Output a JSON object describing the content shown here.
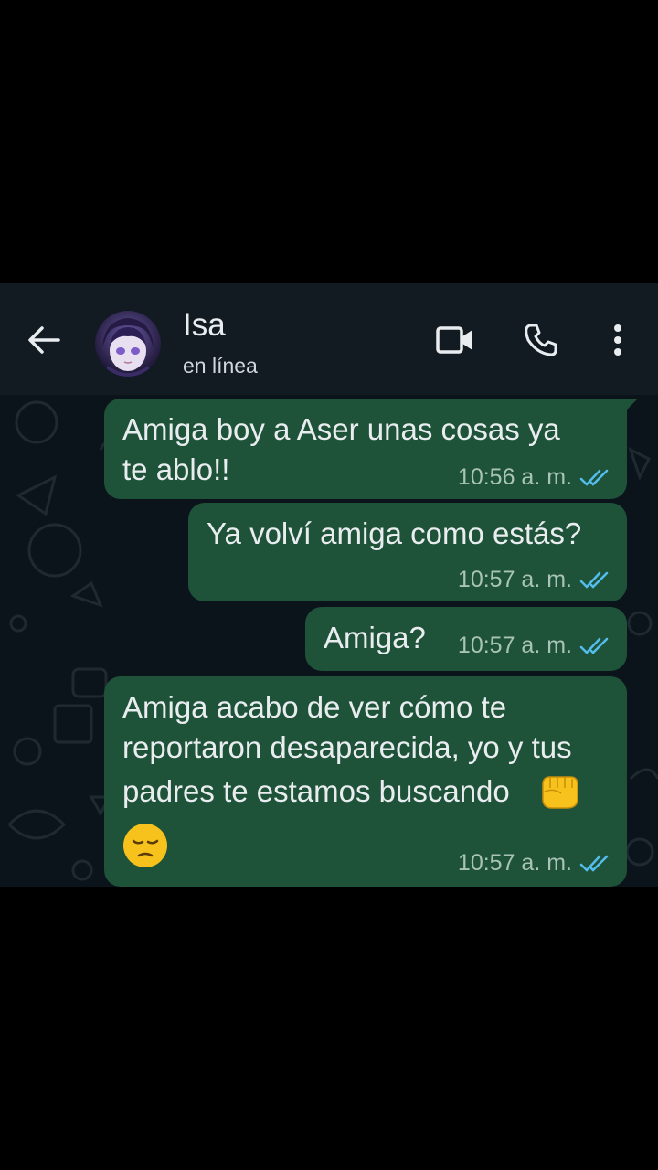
{
  "header": {
    "contact_name": "Isa",
    "status": "en línea",
    "background_color": "#111b21",
    "icons": [
      "back-arrow-icon",
      "video-call-icon",
      "phone-icon",
      "more-options-icon"
    ]
  },
  "chat": {
    "background_color": "#0b141a",
    "bubble_color": "#1e5239",
    "tick_color": "#53bdeb",
    "messages": [
      {
        "lines": [
          "Amiga boy a Aser unas cosas ya",
          "te ablo!!"
        ],
        "time": "10:56 a. m.",
        "status": "read",
        "direction": "outgoing"
      },
      {
        "lines": [
          "Ya volví amiga como estás?"
        ],
        "time": "10:57 a. m.",
        "status": "read",
        "direction": "outgoing"
      },
      {
        "lines": [
          "Amiga?"
        ],
        "time": "10:57 a. m.",
        "status": "read",
        "direction": "outgoing"
      },
      {
        "lines": [
          "Amiga acabo de ver cómo te",
          "reportaron desaparecida, yo y tus",
          "padres te estamos buscando"
        ],
        "emojis": [
          "oncoming-fist-emoji",
          "pensive-face-emoji"
        ],
        "time": "10:57 a. m.",
        "status": "read",
        "direction": "outgoing"
      }
    ]
  }
}
